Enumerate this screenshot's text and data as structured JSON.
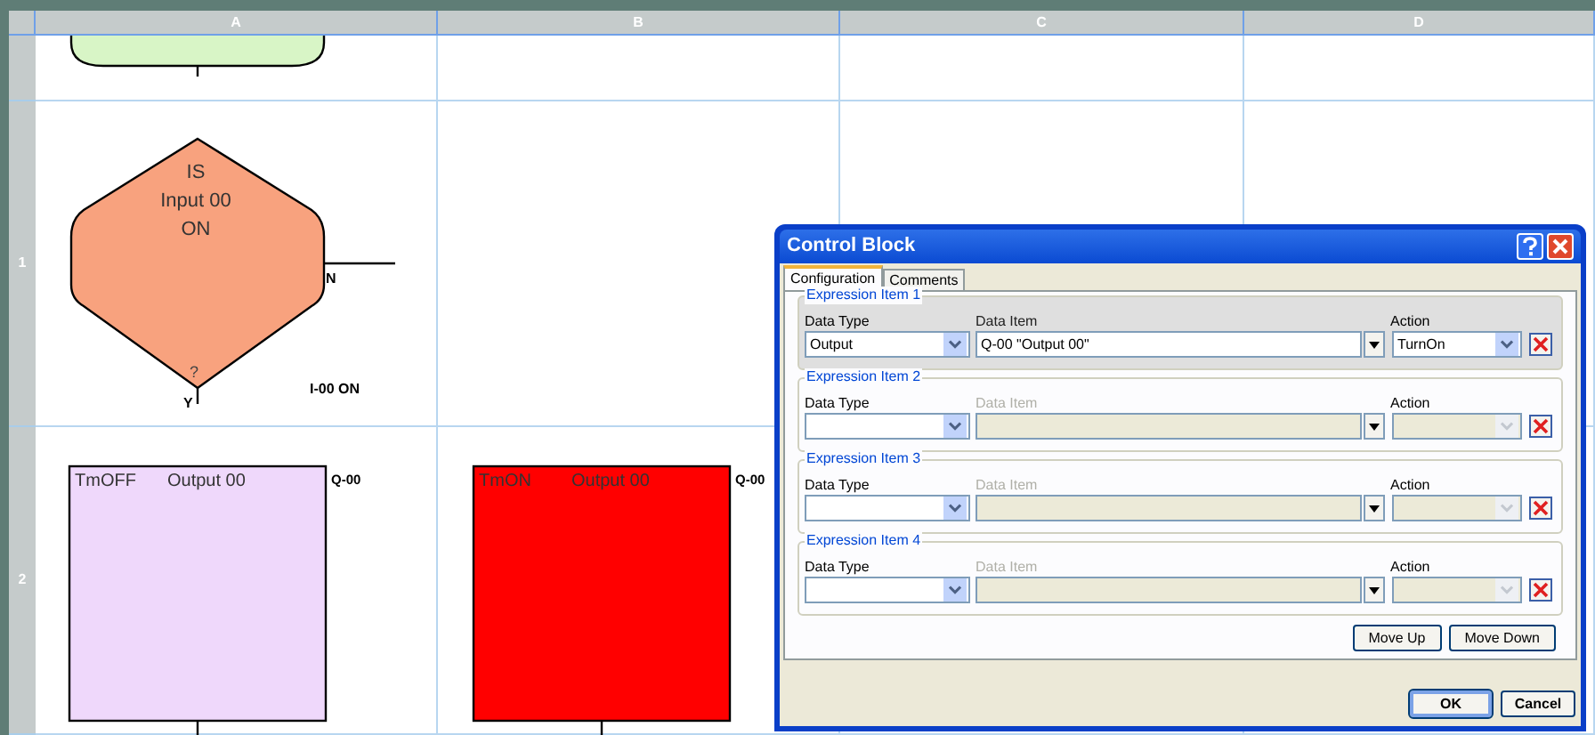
{
  "sheet": {
    "columns": [
      "A",
      "B",
      "C",
      "D"
    ],
    "row_headers": [
      "1",
      "2"
    ]
  },
  "diagram": {
    "nodes": [
      {
        "kind": "terminal",
        "color": "#d8f5c6"
      },
      {
        "kind": "decision",
        "color": "#f8a27e",
        "lines": [
          "IS",
          "Input 00",
          "ON"
        ],
        "mark": "?",
        "yes_label": "Y",
        "no_label": "N",
        "caption": "I-00 ON"
      },
      {
        "kind": "action",
        "color": "#efd8fb",
        "command": "TmOFF",
        "target": "Output 00",
        "tag": "Q-00"
      },
      {
        "kind": "action",
        "color": "#ff0000",
        "command": "TmON",
        "target": "Output 00",
        "tag": "Q-00"
      }
    ]
  },
  "dialog": {
    "title": "Control Block",
    "tabs": [
      {
        "label": "Configuration",
        "selected": true
      },
      {
        "label": "Comments",
        "selected": false
      }
    ],
    "items": [
      {
        "title": "Expression Item 1",
        "selected": true,
        "enabled": true,
        "data_type_label": "Data Type",
        "data_type_value": "Output",
        "data_item_label": "Data Item",
        "data_item_value": "Q-00 \"Output 00\"",
        "action_label": "Action",
        "action_value": "TurnOn"
      },
      {
        "title": "Expression Item 2",
        "selected": false,
        "enabled": false,
        "data_type_label": "Data Type",
        "data_item_label": "Data Item",
        "action_label": "Action"
      },
      {
        "title": "Expression Item 3",
        "selected": false,
        "enabled": false,
        "data_type_label": "Data Type",
        "data_item_label": "Data Item",
        "action_label": "Action"
      },
      {
        "title": "Expression Item 4",
        "selected": false,
        "enabled": false,
        "data_type_label": "Data Type",
        "data_item_label": "Data Item",
        "action_label": "Action"
      }
    ],
    "move_buttons": [
      "Move Up",
      "Move Down"
    ],
    "footer_buttons": [
      {
        "label": "OK",
        "default": true
      },
      {
        "label": "Cancel",
        "default": false
      }
    ]
  }
}
